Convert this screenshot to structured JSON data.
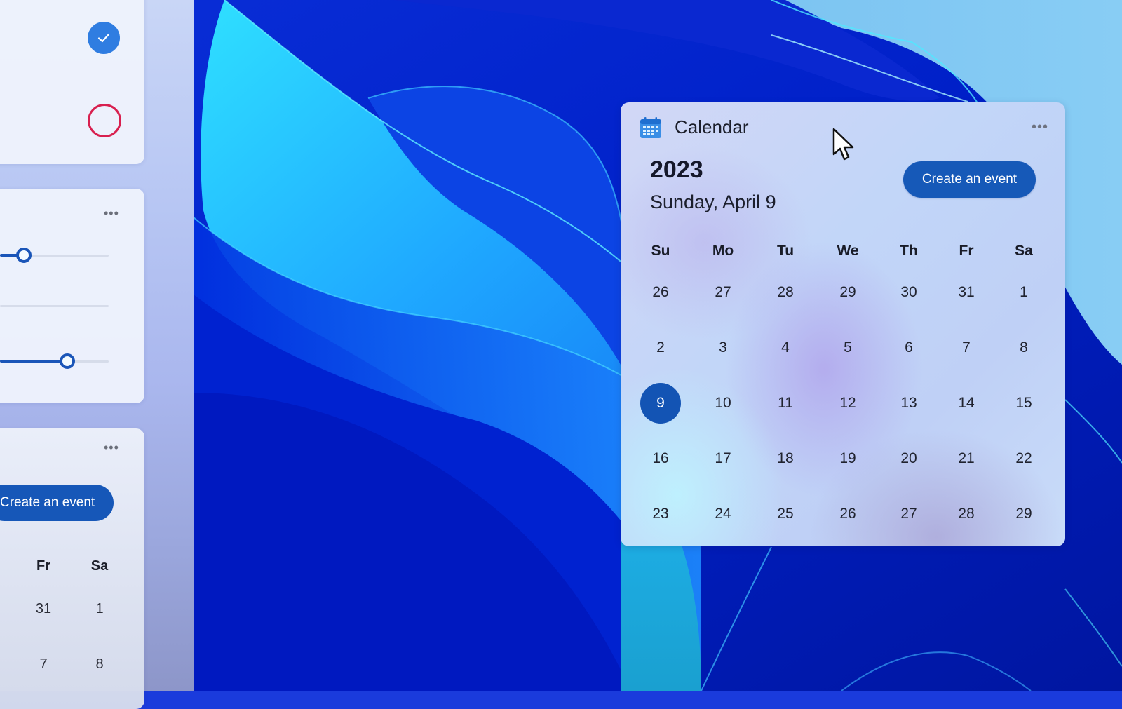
{
  "left_panel": {
    "card_a": {
      "check_state": "checked",
      "ring_state": "unchecked"
    },
    "card_b": {
      "more_label": "•••",
      "sliders": [
        {
          "value_fraction": 0.18
        },
        {
          "value_fraction": 0.0
        },
        {
          "value_fraction": 0.58
        }
      ]
    },
    "card_c": {
      "more_label": "•••",
      "create_button": "Create an event",
      "day_headers": [
        "Fr",
        "Sa"
      ],
      "rows": [
        [
          "31",
          "1"
        ],
        [
          "7",
          "8"
        ]
      ]
    }
  },
  "calendar": {
    "title": "Calendar",
    "more_label": "•••",
    "year": "2023",
    "selected_date_text": "Sunday, April 9",
    "create_button": "Create an event",
    "day_headers": [
      "Su",
      "Mo",
      "Tu",
      "We",
      "Th",
      "Fr",
      "Sa"
    ],
    "weeks": [
      [
        "26",
        "27",
        "28",
        "29",
        "30",
        "31",
        "1"
      ],
      [
        "2",
        "3",
        "4",
        "5",
        "6",
        "7",
        "8"
      ],
      [
        "9",
        "10",
        "11",
        "12",
        "13",
        "14",
        "15"
      ],
      [
        "16",
        "17",
        "18",
        "19",
        "20",
        "21",
        "22"
      ],
      [
        "23",
        "24",
        "25",
        "26",
        "27",
        "28",
        "29"
      ]
    ],
    "selected_day": "9",
    "accent_color": "#1354b4"
  },
  "colors": {
    "accent": "#1659b8",
    "check_blue": "#2f7de1",
    "ring_red": "#d8204f"
  }
}
